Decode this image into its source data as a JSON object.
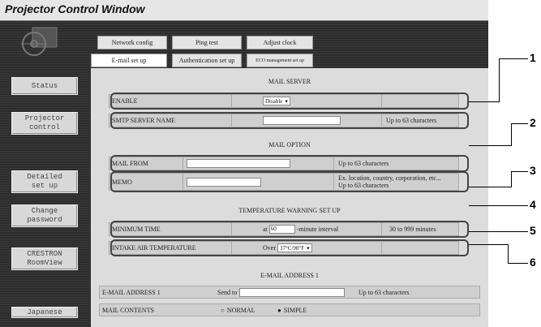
{
  "window": {
    "title": "Projector Control Window"
  },
  "sidebar": {
    "items": [
      {
        "label": "Status"
      },
      {
        "label": "Projector control"
      },
      {
        "label": "Detailed set up"
      },
      {
        "label": "Change password"
      },
      {
        "label": "CRESTRON RoomView"
      },
      {
        "label": "Japanese"
      }
    ]
  },
  "tabs": {
    "top": [
      "Network config",
      "Ping test",
      "Adjust clock"
    ],
    "bottom": [
      "E-mail set up",
      "Authentication set up",
      "ECO management set up"
    ]
  },
  "mail_server": {
    "heading": "MAIL SERVER",
    "enable_label": "ENABLE",
    "enable_value": "Disable",
    "smtp_label": "SMTP SERVER NAME",
    "smtp_note": "Up to 63 characters"
  },
  "mail_option": {
    "heading": "MAIL OPTION",
    "from_label": "MAIL FROM",
    "from_note": "Up to 63 characters",
    "memo_label": "MEMO",
    "memo_note1": "Ex. location, country, corporation, etc...",
    "memo_note2": "Up to 63 characters"
  },
  "temperature": {
    "heading": "TEMPERATURE WARNING SET UP",
    "min_time_label": "MINIMUM TIME",
    "at": "at",
    "min_time_value": "60",
    "interval": "-minute interval",
    "range": "30 to 999 minutes",
    "intake_label": "INTAKE AIR TEMPERATURE",
    "over": "Over",
    "temp_value": "37°C/98°F"
  },
  "email1": {
    "heading": "E-MAIL ADDRESS 1",
    "address_label": "E-MAIL ADDRESS 1",
    "send_to": "Send to",
    "note": "Up to 63 characters",
    "contents_label": "MAIL CONTENTS",
    "opt_normal": "NORMAL",
    "opt_simple": "SIMPLE"
  },
  "callouts": [
    "1",
    "2",
    "3",
    "4",
    "5",
    "6"
  ]
}
